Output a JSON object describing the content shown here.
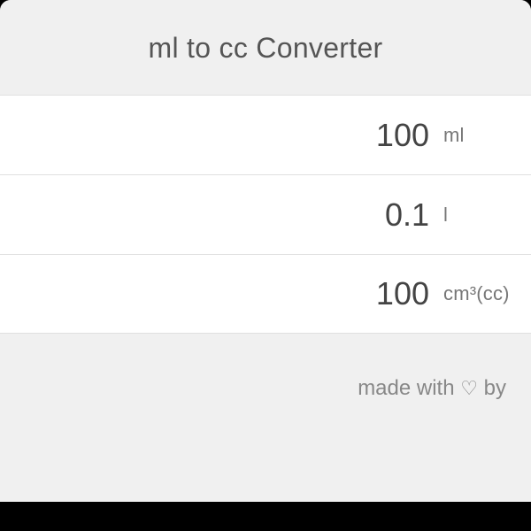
{
  "header": {
    "title": "ml to cc Converter"
  },
  "rows": [
    {
      "value": "100",
      "unit": "ml"
    },
    {
      "value": "0.1",
      "unit": "l"
    },
    {
      "value": "100",
      "unit": "cm³(cc)"
    }
  ],
  "footer": {
    "prefix": "made with ",
    "heart": "♡",
    "suffix": " by"
  }
}
